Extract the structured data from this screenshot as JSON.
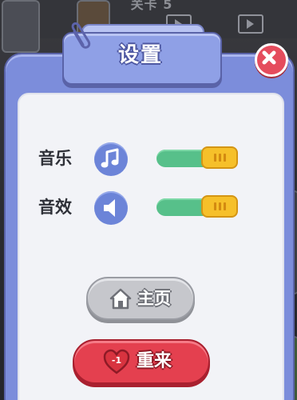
{
  "background": {
    "top_text": "关卡 5"
  },
  "dialog": {
    "title": "设置",
    "close_icon": "close-icon"
  },
  "settings": {
    "music": {
      "label": "音乐",
      "icon": "music-note-icon",
      "enabled": true
    },
    "sound": {
      "label": "音效",
      "icon": "speaker-icon",
      "enabled": true
    }
  },
  "buttons": {
    "home_label": "主页",
    "restart_label": "重来",
    "restart_cost": "-1"
  },
  "colors": {
    "panel": "#7c8ddb",
    "toggle_on": "#57c08a",
    "knob": "#f6c02a",
    "home_button": "#c6c7cc",
    "restart_button": "#e4404f",
    "close_button": "#e54c5d"
  }
}
